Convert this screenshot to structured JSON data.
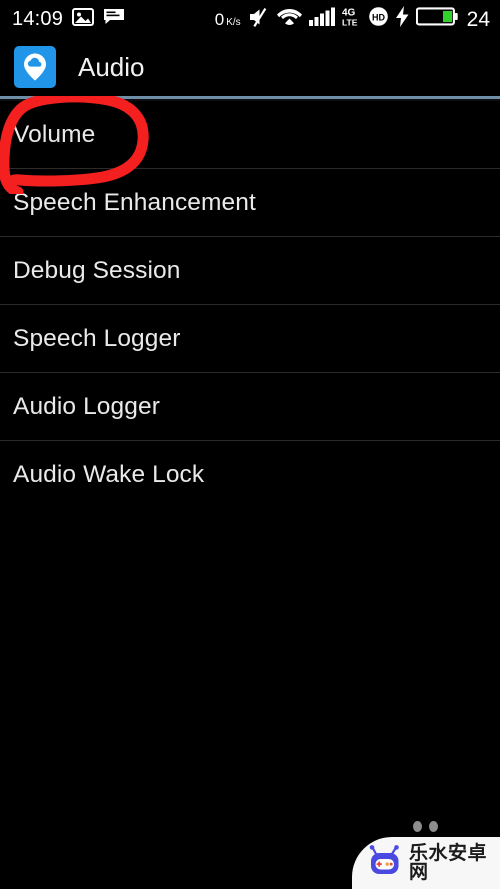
{
  "statusbar": {
    "time": "14:09",
    "left_icons": [
      "photo-icon",
      "message-icon"
    ],
    "network_speed": "0",
    "network_speed_unit": "K/s",
    "right_icons": [
      "volume-mute-icon",
      "wifi-icon",
      "signal-bars-icon",
      "4g-lte-icon",
      "hd-voice-icon",
      "charging-bolt-icon",
      "battery-icon"
    ],
    "network_type_top": "4G",
    "network_type_bottom": "LTE",
    "hd_label": "HD",
    "battery_percent": "24"
  },
  "actionbar": {
    "app_icon": "cloud-pin-icon",
    "title": "Audio",
    "accent_color": "#2196e8",
    "underline_color": "#6f8ea8"
  },
  "list": {
    "items": [
      {
        "label": "Volume",
        "annotated": true
      },
      {
        "label": "Speech Enhancement",
        "annotated": false
      },
      {
        "label": "Debug Session",
        "annotated": false
      },
      {
        "label": "Speech Logger",
        "annotated": false
      },
      {
        "label": "Audio Logger",
        "annotated": false
      },
      {
        "label": "Audio Wake Lock",
        "annotated": false
      }
    ]
  },
  "annotation": {
    "shape": "hand-drawn-red-circle",
    "target": "Volume",
    "color": "#f42020"
  },
  "watermark": {
    "text": "乐水安卓网",
    "logo": "robot-mascot-icon",
    "logo_color": "#4a4ae0"
  }
}
